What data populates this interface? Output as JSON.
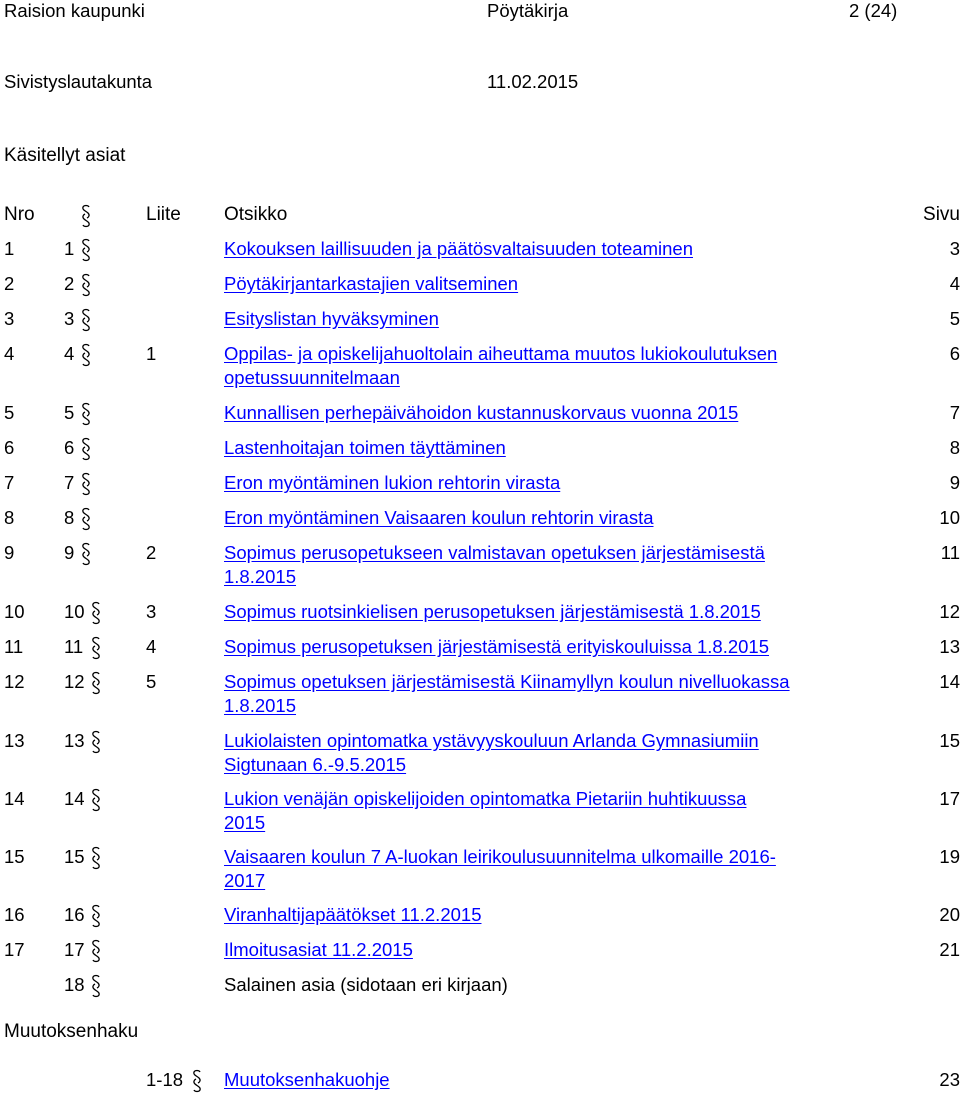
{
  "header": {
    "org": "Raision kaupunki",
    "doc_type": "Pöytäkirja",
    "page": "2 (24)",
    "body": "Sivistyslautakunta",
    "date": "11.02.2015"
  },
  "title": "Käsitellyt asiat",
  "columns": {
    "nro": "Nro",
    "liite": "Liite",
    "otsikko": "Otsikko",
    "sivu": "Sivu"
  },
  "rows": [
    {
      "nro": "1",
      "pykala": "1",
      "liite": "",
      "lines": [
        "Kokouksen laillisuuden ja päätösvaltaisuuden toteaminen"
      ],
      "sivu": "3",
      "link": true
    },
    {
      "nro": "2",
      "pykala": "2",
      "liite": "",
      "lines": [
        "Pöytäkirjantarkastajien valitseminen"
      ],
      "sivu": "4",
      "link": true
    },
    {
      "nro": "3",
      "pykala": "3",
      "liite": "",
      "lines": [
        "Esityslistan hyväksyminen"
      ],
      "sivu": "5",
      "link": true
    },
    {
      "nro": "4",
      "pykala": "4",
      "liite": "1",
      "lines": [
        "Oppilas- ja opiskelijahuoltolain aiheuttama muutos lukiokoulutuksen",
        "opetussuunnitelmaan"
      ],
      "sivu": "6",
      "link": true
    },
    {
      "nro": "5",
      "pykala": "5",
      "liite": "",
      "lines": [
        "Kunnallisen perhepäivähoidon kustannuskorvaus vuonna 2015"
      ],
      "sivu": "7",
      "link": true
    },
    {
      "nro": "6",
      "pykala": "6",
      "liite": "",
      "lines": [
        "Lastenhoitajan toimen täyttäminen"
      ],
      "sivu": "8",
      "link": true
    },
    {
      "nro": "7",
      "pykala": "7",
      "liite": "",
      "lines": [
        "Eron myöntäminen lukion rehtorin virasta"
      ],
      "sivu": "9",
      "link": true
    },
    {
      "nro": "8",
      "pykala": "8",
      "liite": "",
      "lines": [
        "Eron myöntäminen Vaisaaren koulun rehtorin virasta"
      ],
      "sivu": "10",
      "link": true
    },
    {
      "nro": "9",
      "pykala": "9",
      "liite": "2",
      "lines": [
        "Sopimus perusopetukseen valmistavan opetuksen järjestämisestä",
        "1.8.2015"
      ],
      "sivu": "11",
      "link": true
    },
    {
      "nro": "10",
      "pykala": "10",
      "liite": "3",
      "lines": [
        "Sopimus ruotsinkielisen perusopetuksen järjestämisestä 1.8.2015"
      ],
      "sivu": "12",
      "link": true
    },
    {
      "nro": "11",
      "pykala": "11",
      "liite": "4",
      "lines": [
        "Sopimus perusopetuksen järjestämisestä erityiskouluissa 1.8.2015"
      ],
      "sivu": "13",
      "link": true
    },
    {
      "nro": "12",
      "pykala": "12",
      "liite": "5",
      "lines": [
        "Sopimus opetuksen järjestämisestä Kiinamyllyn koulun nivelluokassa",
        "1.8.2015"
      ],
      "sivu": "14",
      "link": true
    },
    {
      "nro": "13",
      "pykala": "13",
      "liite": "",
      "lines": [
        "Lukiolaisten opintomatka ystävyyskouluun Arlanda Gymnasiumiin",
        "Sigtunaan 6.-9.5.2015"
      ],
      "sivu": "15",
      "link": true
    },
    {
      "nro": "14",
      "pykala": "14",
      "liite": "",
      "lines": [
        "Lukion venäjän opiskelijoiden opintomatka Pietariin huhtikuussa",
        "2015"
      ],
      "sivu": "17",
      "link": true
    },
    {
      "nro": "15",
      "pykala": "15",
      "liite": "",
      "lines": [
        "Vaisaaren koulun 7 A-luokan leirikoulusuunnitelma ulkomaille 2016-",
        "2017"
      ],
      "sivu": "19",
      "link": true
    },
    {
      "nro": "16",
      "pykala": "16",
      "liite": "",
      "lines": [
        "Viranhaltijapäätökset 11.2.2015"
      ],
      "sivu": "20",
      "link": true
    },
    {
      "nro": "17",
      "pykala": "17",
      "liite": "",
      "lines": [
        "Ilmoitusasiat 11.2.2015"
      ],
      "sivu": "21",
      "link": true
    },
    {
      "nro": "",
      "pykala": "18",
      "liite": "",
      "lines": [
        "Salainen asia (sidotaan eri kirjaan)"
      ],
      "sivu": "",
      "link": false
    }
  ],
  "appeal": {
    "title": "Muutoksenhaku",
    "range": "1-18",
    "label": "Muutoksenhakuohje",
    "sivu": "23"
  }
}
